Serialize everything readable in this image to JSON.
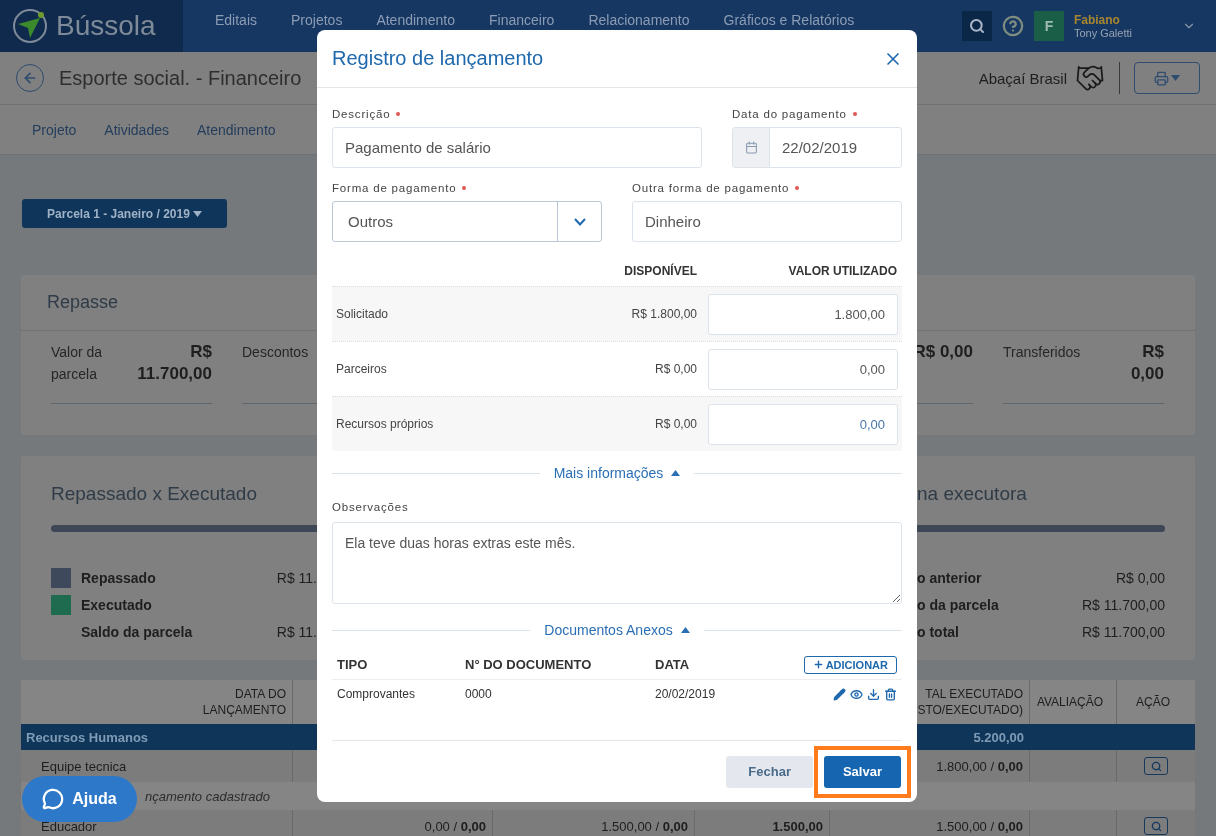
{
  "topbar": {
    "brand": "Bússola",
    "nav": [
      {
        "label": "Editais"
      },
      {
        "label": "Projetos"
      },
      {
        "label": "Atendimento"
      },
      {
        "label": "Financeiro"
      },
      {
        "label": "Relacionamento"
      },
      {
        "label": "Gráficos e Relatórios"
      }
    ],
    "user": {
      "initial": "F",
      "name": "Fabiano",
      "subtitle": "Tony Galetti"
    }
  },
  "page_header": {
    "title": "Esporte social. - Financeiro",
    "organization": "Abaçaí Brasil"
  },
  "tabs": [
    {
      "label": "Projeto"
    },
    {
      "label": "Atividades"
    },
    {
      "label": "Atendimento"
    }
  ],
  "parcela_button": "Parcela 1 - Janeiro / 2019",
  "repasse": {
    "title": "Repasse",
    "left": [
      {
        "label": "Valor da parcela",
        "value": "R$ 11.700,00"
      },
      {
        "label": "Descontos"
      }
    ],
    "right": [
      {
        "value": "R$ 0,00"
      },
      {
        "label": "Transferidos",
        "value": "R$ 0,00"
      }
    ]
  },
  "balance": {
    "title": "Repassado x Executado",
    "legend": [
      {
        "label": "Repassado",
        "color": "#3e4a5c",
        "value": "R$ 11."
      },
      {
        "label": "Executado",
        "color": "#1f6b4f"
      },
      {
        "label": "Saldo da parcela",
        "value": "R$ 11."
      }
    ],
    "right_title": "na executora",
    "right_rows": [
      {
        "label": "o anterior",
        "value": "R$ 0,00"
      },
      {
        "label": "o da parcela",
        "value": "R$ 11.700,00"
      },
      {
        "label": "o total",
        "value": "R$ 11.700,00"
      }
    ]
  },
  "table": {
    "header": {
      "column_1": "DATA DO LANÇAMENTO",
      "column_5": "TAL EXECUTADO STO/EXECUTADO)",
      "column_6": "AVALIAÇÃO",
      "column_7": "AÇÃO"
    },
    "rows": [
      {
        "kind": "group",
        "cells": {
          "column_1": "Recursos Humanos",
          "column_5": "5.200,00"
        }
      },
      {
        "kind": "item",
        "search_button": true,
        "cells": {
          "column_1": "Equipe tecnica",
          "column_5": "1.800,00 / **0,00**"
        }
      },
      {
        "kind": "empty",
        "cells": {
          "column_1": "nçamento cadastrado"
        }
      },
      {
        "kind": "item",
        "search_button": true,
        "cells": {
          "column_1": "Educador",
          "column_2": "0,00 / **0,00**",
          "column_3": "1.500,00 / **0,00**",
          "column_4": "1.500,00",
          "column_5": "1.500,00 / **0,00**"
        }
      }
    ]
  },
  "help_button": "Ajuda",
  "dialog": {
    "title": "Registro de lançamento",
    "fields": [
      {
        "kind": "text",
        "label": "Descrição",
        "required": true,
        "value": "Pagamento de salário"
      },
      {
        "kind": "date",
        "label": "Data do pagamento",
        "required": true,
        "value": "22/02/2019"
      },
      {
        "kind": "select",
        "label": "Forma de pagamento",
        "required": true,
        "value": "Outros"
      },
      {
        "kind": "text",
        "label": "Outra forma de pagamento",
        "required": true,
        "value": "Dinheiro"
      }
    ],
    "amounts": {
      "columns": [
        "DISPONÍVEL",
        "VALOR UTILIZADO"
      ],
      "rows": [
        {
          "label": "Solicitado",
          "available": "R$ 1.800,00",
          "used": "1.800,00"
        },
        {
          "label": "Parceiros",
          "available": "R$ 0,00",
          "used": "0,00"
        },
        {
          "label": "Recursos próprios",
          "available": "R$ 0,00",
          "used": "0,00"
        }
      ]
    },
    "more_info": {
      "label": "Mais informações",
      "expanded": true
    },
    "notes": {
      "label": "Observações",
      "value": "Ela teve duas horas extras este mês."
    },
    "attachments": {
      "label": "Documentos Anexos",
      "expanded": true,
      "columns": [
        "TIPO",
        "N° DO DOCUMENTO",
        "DATA"
      ],
      "add_button": "ADICIONAR",
      "rows": [
        {
          "type": "Comprovantes",
          "number": "0000",
          "date": "20/02/2019"
        }
      ]
    },
    "buttons": [
      {
        "label": "Fechar",
        "kind": "secondary",
        "highlighted": false
      },
      {
        "label": "Salvar",
        "kind": "primary",
        "highlighted": true
      }
    ]
  }
}
